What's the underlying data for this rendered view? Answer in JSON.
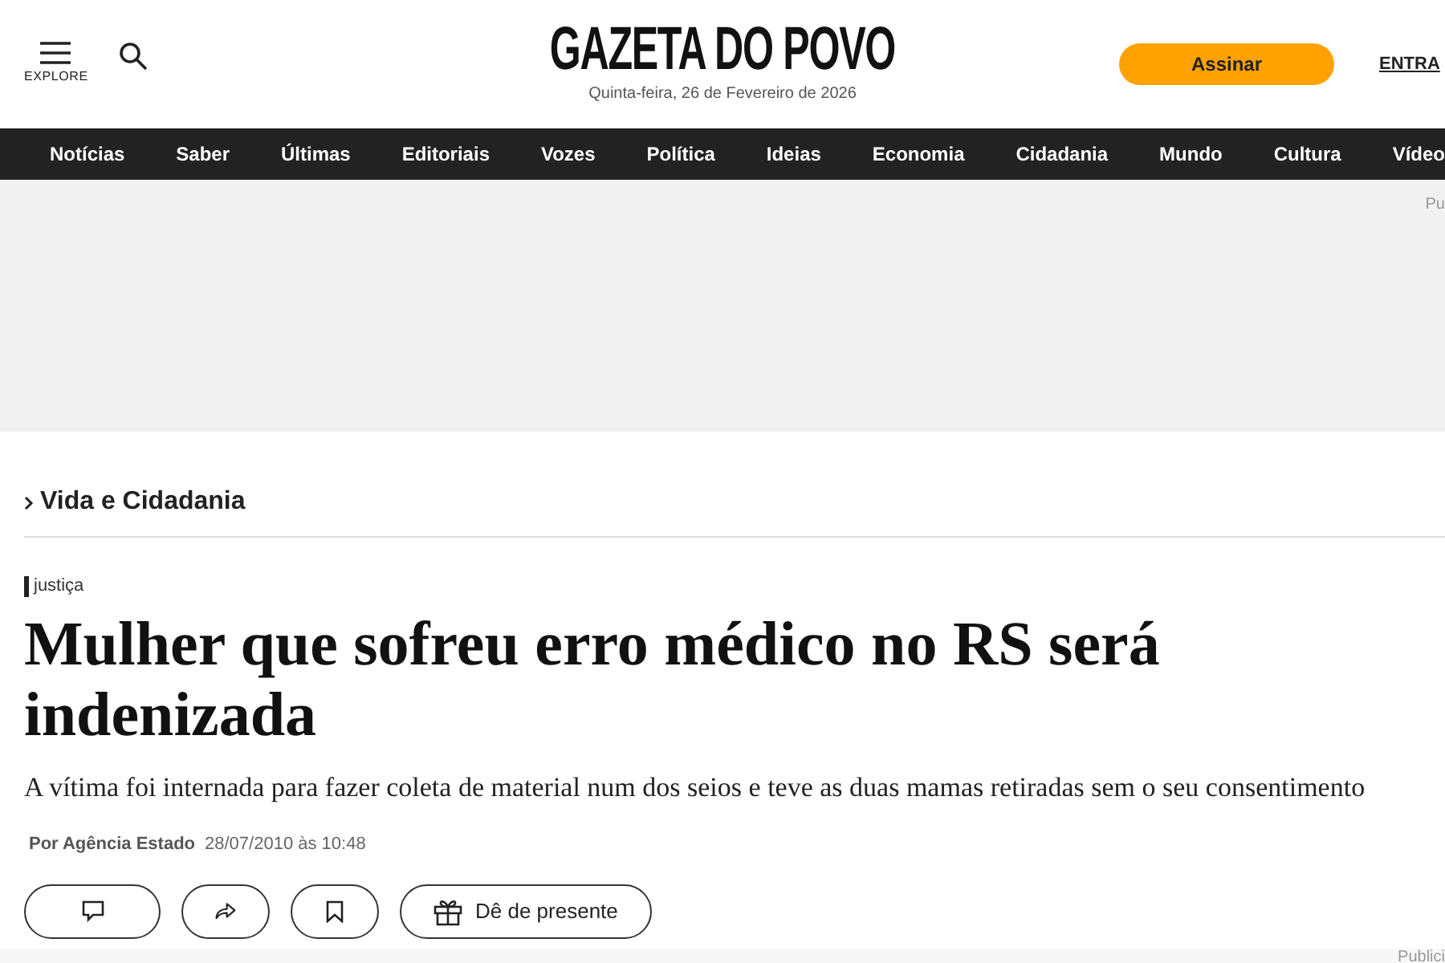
{
  "header": {
    "menu_label": "EXPLORE",
    "logo": "GAZETA DO POVO",
    "date": "Quinta-feira, 26 de Fevereiro de 2026",
    "subscribe_button": "Assinar",
    "login_link": "ENTRA"
  },
  "nav": [
    {
      "label": "Notícias"
    },
    {
      "label": "Saber"
    },
    {
      "label": "Últimas"
    },
    {
      "label": "Editoriais"
    },
    {
      "label": "Vozes"
    },
    {
      "label": "Política"
    },
    {
      "label": "Ideias"
    },
    {
      "label": "Economia"
    },
    {
      "label": "Cidadania"
    },
    {
      "label": "Mundo"
    },
    {
      "label": "Cultura"
    },
    {
      "label": "Vídeo"
    }
  ],
  "ad_top": {
    "label": "Pu"
  },
  "article": {
    "section": "Vida e Cidadania",
    "tag": "justiça",
    "headline": "Mulher que sofreu erro médico no RS será indenizada",
    "subtitle": "A vítima foi internada para fazer coleta de material num dos seios e teve as duas mamas retiradas sem o seu consentimento",
    "author": "Por Agência Estado",
    "date": "28/07/2010 às 10:48",
    "actions": [
      {
        "kind": "comment"
      },
      {
        "kind": "share"
      },
      {
        "kind": "bookmark"
      },
      {
        "kind": "gift",
        "label": "Dê de presente"
      }
    ]
  },
  "ad_bottom": {
    "label": "Publici"
  }
}
